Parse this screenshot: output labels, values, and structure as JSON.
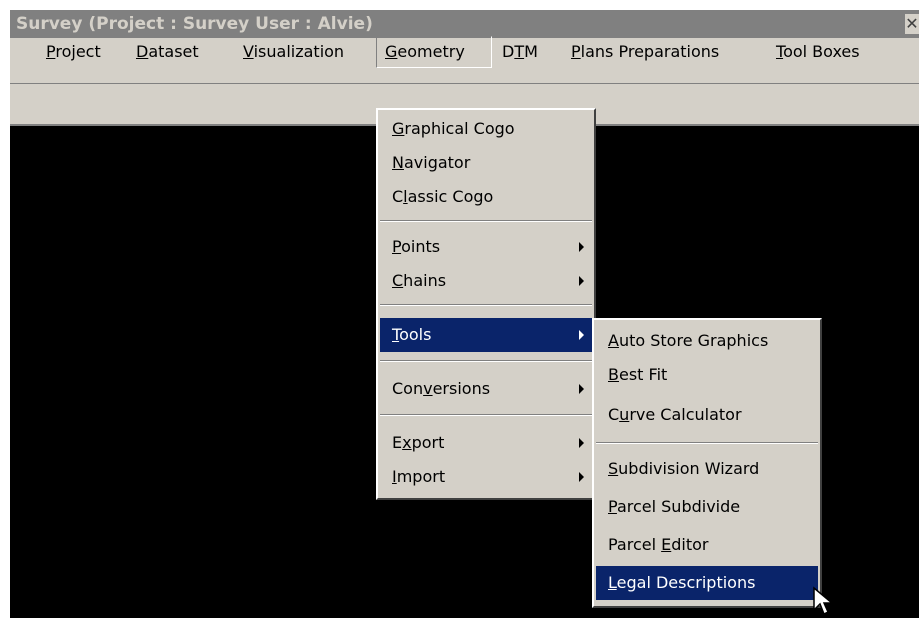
{
  "window": {
    "title": "Survey (Project : Survey   User : Alvie)",
    "close_glyph": "✕"
  },
  "menubar": {
    "items": [
      {
        "pre": "",
        "key": "P",
        "post": "roject"
      },
      {
        "pre": "",
        "key": "D",
        "post": "ataset"
      },
      {
        "pre": "",
        "key": "V",
        "post": "isualization"
      },
      {
        "pre": "",
        "key": "G",
        "post": "eometry"
      },
      {
        "pre": "D",
        "key": "T",
        "post": "M"
      },
      {
        "pre": "",
        "key": "P",
        "post": "lans Preparations"
      },
      {
        "pre": "",
        "key": "T",
        "post": "ool Boxes"
      }
    ]
  },
  "geometry_menu": {
    "items": [
      {
        "pre": "",
        "key": "G",
        "post": "raphical Cogo",
        "submenu": false
      },
      {
        "pre": "",
        "key": "N",
        "post": "avigator",
        "submenu": false
      },
      {
        "pre": "C",
        "key": "l",
        "post": "assic Cogo",
        "submenu": false
      },
      {
        "pre": "",
        "key": "P",
        "post": "oints",
        "submenu": true
      },
      {
        "pre": "",
        "key": "C",
        "post": "hains",
        "submenu": true
      },
      {
        "pre": "",
        "key": "T",
        "post": "ools",
        "submenu": true
      },
      {
        "pre": "Con",
        "key": "v",
        "post": "ersions",
        "submenu": true
      },
      {
        "pre": "E",
        "key": "x",
        "post": "port",
        "submenu": true
      },
      {
        "pre": "",
        "key": "I",
        "post": "mport",
        "submenu": true
      }
    ]
  },
  "tools_menu": {
    "items": [
      {
        "pre": "",
        "key": "A",
        "post": "uto Store Graphics"
      },
      {
        "pre": "",
        "key": "B",
        "post": "est Fit"
      },
      {
        "pre": "C",
        "key": "u",
        "post": "rve Calculator"
      },
      {
        "pre": "",
        "key": "S",
        "post": "ubdivision Wizard"
      },
      {
        "pre": "",
        "key": "P",
        "post": "arcel Subdivide"
      },
      {
        "pre": "Parcel ",
        "key": "E",
        "post": "ditor"
      },
      {
        "pre": "",
        "key": "L",
        "post": "egal Descriptions"
      }
    ]
  },
  "colors": {
    "face": "#d4d0c8",
    "highlight": "#0a246a",
    "title_inactive": "#808080",
    "canvas": "#000000"
  }
}
